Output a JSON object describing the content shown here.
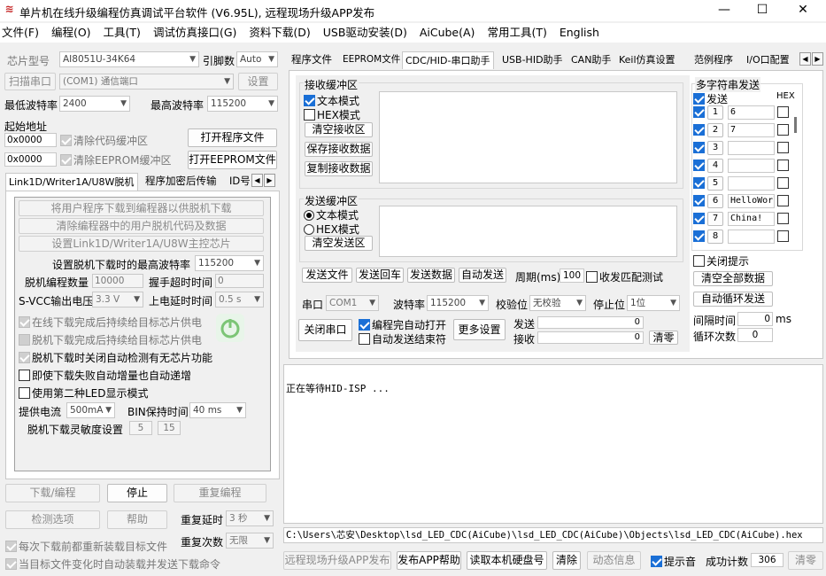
{
  "window": {
    "title": "单片机在线升级编程仿真调试平台软件 (V6.95L), 远程现场升级APP发布",
    "app_icon": "logo-icon",
    "min": "—",
    "max": "☐",
    "close": "✕"
  },
  "menu": [
    "文件(F)",
    "编程(O)",
    "工具(T)",
    "调试仿真接口(G)",
    "资料下载(D)",
    "USB驱动安装(D)",
    "AiCube(A)",
    "常用工具(T)",
    "English"
  ],
  "left": {
    "chip_label": "芯片型号",
    "chip_value": "AI8051U-34K64",
    "pin_label": "引脚数",
    "pin_value": "Auto",
    "scan_label": "扫描串口",
    "port_value": "(COM1) 通信端口",
    "settings_btn": "设置",
    "min_baud_label": "最低波特率",
    "min_baud": "2400",
    "max_baud_label": "最高波特率",
    "max_baud": "115200",
    "start_addr_label": "起始地址",
    "addr1": "0x0000",
    "clear_code": "清除代码缓冲区",
    "open_prog": "打开程序文件",
    "addr2": "0x0000",
    "clear_eeprom": "清除EEPROM缓冲区",
    "open_eeprom": "打开EEPROM文件",
    "tabs": [
      "Link1D/Writer1A/U8W脱机",
      "程序加密后传输",
      "ID号"
    ],
    "offline": {
      "btn1": "将用户程序下载到编程器以供脱机下载",
      "btn2": "清除编程器中的用户脱机代码及数据",
      "btn3": "设置Link1D/Writer1A/U8W主控芯片",
      "max_baud_label": "设置脱机下载时的最高波特率",
      "max_baud": "115200",
      "count_label": "脱机编程数量",
      "count": "10000",
      "timeout_label": "握手超时时间",
      "timeout": "0",
      "svcc_label": "S-VCC输出电压",
      "svcc": "3.3 V",
      "delay_label": "上电延时时间",
      "delay": "0.5 s",
      "opts": [
        "在线下载完成后持续给目标芯片供电",
        "脱机下载完成后持续给目标芯片供电",
        "脱机下载时关闭自动检测有无芯片功能",
        "即使下载失败自动增量也自动递增",
        "使用第二种LED显示模式"
      ],
      "current_label": "提供电流",
      "current": "500mA",
      "bin_label": "BIN保持时间",
      "bin": "40 ms",
      "sens_label": "脱机下载灵敏度设置",
      "sens1": "5",
      "sens2": "15"
    },
    "btn_download": "下载/编程",
    "btn_stop": "停止",
    "btn_reprog": "重复编程",
    "btn_detect": "检测选项",
    "btn_help": "帮助",
    "repeat_delay_label": "重复延时",
    "repeat_delay": "3 秒",
    "repeat_count_label": "重复次数",
    "repeat_count": "无限",
    "chk_reload": "每次下载前都重新装载目标文件",
    "chk_autosend": "当目标文件变化时自动装载并发送下载命令"
  },
  "right": {
    "tabs": [
      "程序文件",
      "EEPROM文件",
      "CDC/HID-串口助手",
      "USB-HID助手",
      "CAN助手",
      "Keil仿真设置",
      "范例程序",
      "I/O口配置"
    ],
    "recv": {
      "title": "接收缓冲区",
      "text_mode": "文本模式",
      "hex_mode": "HEX模式",
      "clear": "清空接收区",
      "save": "保存接收数据",
      "copy": "复制接收数据"
    },
    "send": {
      "title": "发送缓冲区",
      "text_mode": "文本模式",
      "hex_mode": "HEX模式",
      "clear": "清空发送区"
    },
    "actions": {
      "send_file": "发送文件",
      "send_enter": "发送回车",
      "send_data": "发送数据",
      "auto_send": "自动发送",
      "period_label": "周期(ms)",
      "period": "100",
      "match": "收发匹配测试"
    },
    "port": {
      "port_label": "串口",
      "port": "COM1",
      "baud_label": "波特率",
      "baud": "115200",
      "parity_label": "校验位",
      "parity": "无校验",
      "stop_label": "停止位",
      "stop": "1位",
      "close_btn": "关闭串口",
      "auto_open": "编程完自动打开",
      "auto_end": "自动发送结束符",
      "more": "更多设置",
      "send_label": "发送",
      "send_count": "0",
      "recv_label": "接收",
      "recv_count": "0",
      "clear_count": "清零"
    },
    "multi": {
      "title": "多字符串发送",
      "send_hdr": "发送",
      "hex_hdr": "HEX",
      "rows": [
        {
          "n": "1",
          "v": "6"
        },
        {
          "n": "2",
          "v": "7"
        },
        {
          "n": "3",
          "v": ""
        },
        {
          "n": "4",
          "v": ""
        },
        {
          "n": "5",
          "v": ""
        },
        {
          "n": "6",
          "v": "HelloWorl"
        },
        {
          "n": "7",
          "v": "China!"
        },
        {
          "n": "8",
          "v": ""
        }
      ],
      "close_hint": "关闭提示",
      "clear_all": "清空全部数据",
      "auto_loop": "自动循环发送",
      "interval_label": "间隔时间",
      "interval": "0",
      "interval_unit": "ms",
      "loop_label": "循环次数",
      "loop": "0"
    },
    "log": "正在等待HID-ISP ...",
    "path": "C:\\Users\\芯安\\Desktop\\lsd_LED_CDC(AiCube)\\lsd_LED_CDC(AiCube)\\Objects\\lsd_LED_CDC(AiCube).hex",
    "bottom": {
      "remote": "远程现场升级APP发布",
      "publish_help": "发布APP帮助",
      "read_disk": "读取本机硬盘号",
      "clear": "清除",
      "anim": "动态信息",
      "sound": "提示音",
      "success_label": "成功计数",
      "success": "306",
      "clear_count": "清零"
    }
  }
}
